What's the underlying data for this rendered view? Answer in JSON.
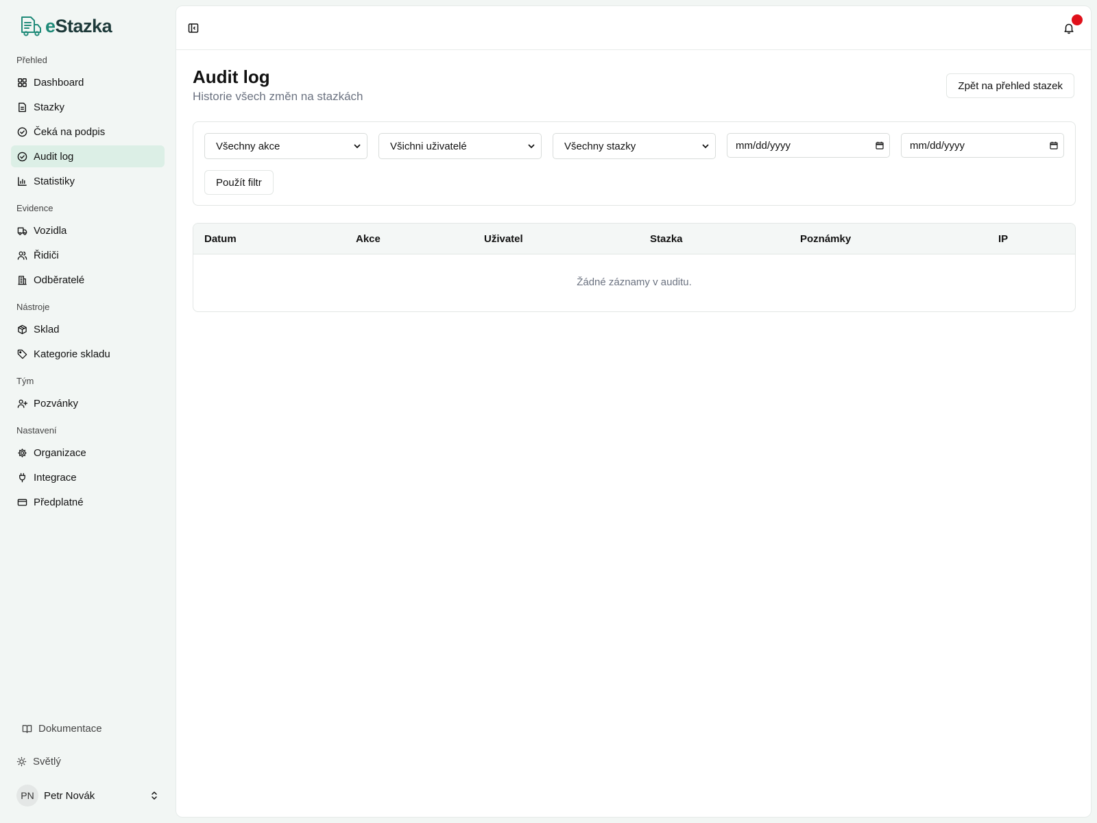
{
  "brand": {
    "prefix": "e",
    "name": "Stazka"
  },
  "sidebar": {
    "sections": [
      {
        "label": "Přehled"
      },
      {
        "label": "Evidence"
      },
      {
        "label": "Nástroje"
      },
      {
        "label": "Tým"
      },
      {
        "label": "Nastavení"
      }
    ],
    "items": [
      {
        "label": "Dashboard",
        "icon": "grid-icon"
      },
      {
        "label": "Stazky",
        "icon": "file-icon"
      },
      {
        "label": "Čeká na podpis",
        "icon": "check-circle-icon"
      },
      {
        "label": "Audit log",
        "icon": "check-circle-icon",
        "active": true
      },
      {
        "label": "Statistiky",
        "icon": "bar-chart-icon"
      },
      {
        "label": "Vozidla",
        "icon": "truck-icon"
      },
      {
        "label": "Řidiči",
        "icon": "users-icon"
      },
      {
        "label": "Odběratelé",
        "icon": "building-icon"
      },
      {
        "label": "Sklad",
        "icon": "box-icon"
      },
      {
        "label": "Kategorie skladu",
        "icon": "tag-icon"
      },
      {
        "label": "Pozvánky",
        "icon": "user-plus-icon"
      },
      {
        "label": "Organizace",
        "icon": "gear-icon"
      },
      {
        "label": "Integrace",
        "icon": "plug-icon"
      },
      {
        "label": "Předplatné",
        "icon": "credit-card-icon"
      }
    ],
    "docs_label": "Dokumentace",
    "theme_label": "Světlý",
    "user": {
      "initials": "PN",
      "name": "Petr Novák"
    }
  },
  "header": {
    "title": "Audit log",
    "subtitle": "Historie všech změn na stazkách",
    "back_button": "Zpět na přehled stazek"
  },
  "filters": {
    "action": "Všechny akce",
    "user": "Všichni uživatelé",
    "stazka": "Všechny stazky",
    "date_from": "mm/dd/yyyy",
    "date_to": "mm/dd/yyyy",
    "apply": "Použít filtr"
  },
  "table": {
    "columns": [
      "Datum",
      "Akce",
      "Uživatel",
      "Stazka",
      "Poznámky",
      "IP"
    ],
    "empty": "Žádné záznamy v auditu."
  },
  "colors": {
    "accent": "#1f8a78",
    "active_bg": "#dcefe6",
    "notification": "#e0101a"
  }
}
